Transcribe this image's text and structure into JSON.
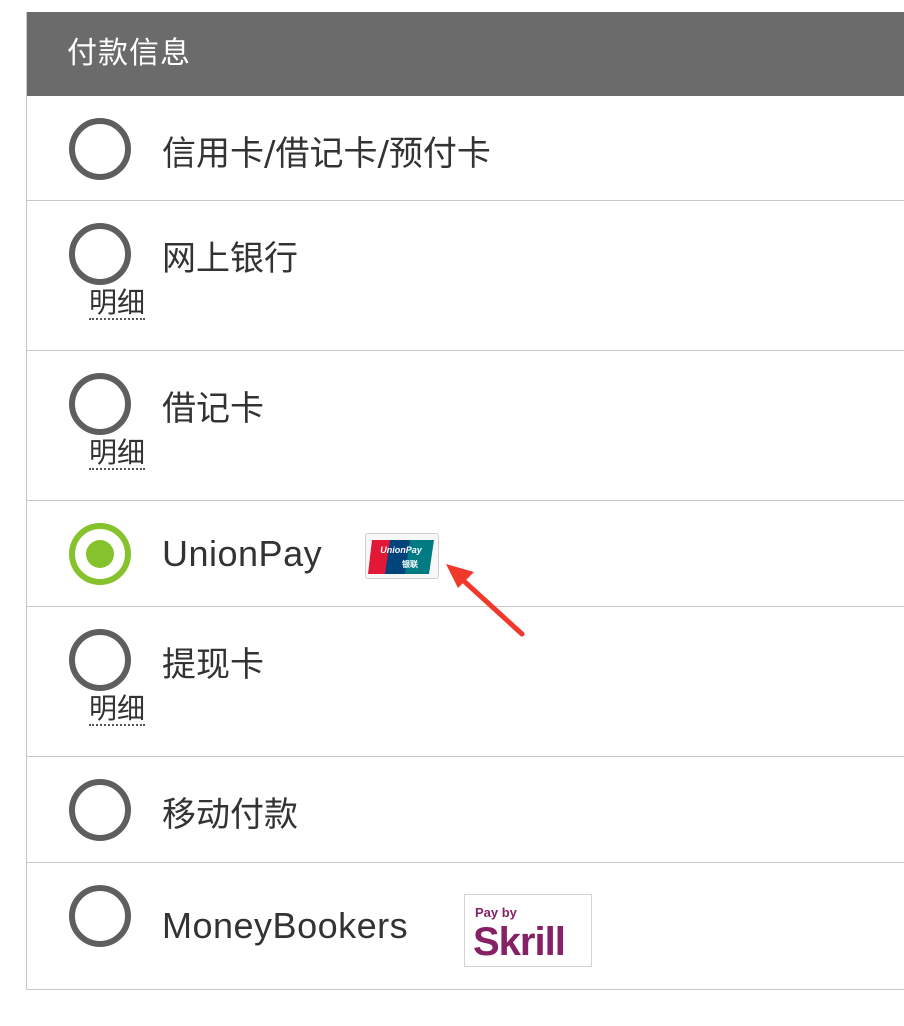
{
  "header": {
    "title": "付款信息"
  },
  "options": [
    {
      "label": "信用卡/借记卡/预付卡",
      "selected": false
    },
    {
      "label": "网上银行",
      "details": "明细",
      "selected": false
    },
    {
      "label": "借记卡",
      "details": "明细",
      "selected": false
    },
    {
      "label": "UnionPay",
      "selected": true,
      "logo_icon": "unionpay-logo-icon",
      "logo_text": "UnionPay 银联"
    },
    {
      "label": "提现卡",
      "details": "明细",
      "selected": false
    },
    {
      "label": "移动付款",
      "selected": false
    },
    {
      "label": "MoneyBookers",
      "selected": false,
      "logo_icon": "skrill-logo-icon",
      "logo_text": {
        "line1": "Pay by",
        "line2": "Skrill"
      }
    }
  ],
  "annotation": {
    "arrow_icon": "red-arrow-icon",
    "arrow_color": "#f0392b"
  },
  "colors": {
    "header_bg": "#6b6b6b",
    "radio_checked": "#86c22b",
    "radio_unchecked": "#5e5e5e",
    "divider": "#c8c8c8",
    "skrill_purple": "#862165"
  }
}
